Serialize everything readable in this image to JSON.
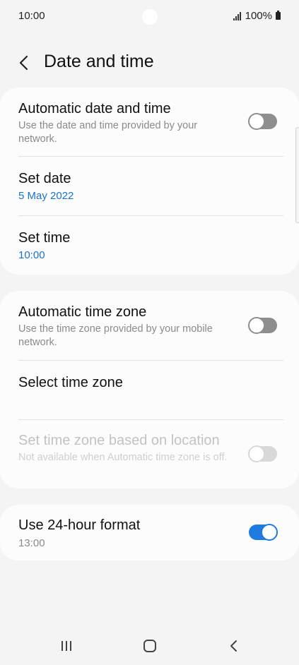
{
  "status_bar": {
    "time": "10:00",
    "battery_text": "100%"
  },
  "header": {
    "title": "Date and time"
  },
  "sections": {
    "automatic_date_time": {
      "title": "Automatic date and time",
      "subtitle": "Use the date and time provided by your network.",
      "enabled": false
    },
    "set_date": {
      "title": "Set date",
      "value": "5 May 2022"
    },
    "set_time": {
      "title": "Set time",
      "value": "10:00"
    },
    "automatic_time_zone": {
      "title": "Automatic time zone",
      "subtitle": "Use the time zone provided by your mobile network.",
      "enabled": false
    },
    "select_time_zone": {
      "title": "Select time zone"
    },
    "time_zone_location": {
      "title": "Set time zone based on location",
      "subtitle": "Not available when Automatic time zone is off.",
      "enabled": false,
      "disabled": true
    },
    "use_24_hour": {
      "title": "Use 24-hour format",
      "value": "13:00",
      "enabled": true
    }
  },
  "colors": {
    "accent": "#1f7be0",
    "link_value": "#1a73c8",
    "background": "#f4f4f4",
    "card": "#fcfcfc"
  },
  "nav_bar": {
    "icons": [
      "recents-icon",
      "home-icon",
      "back-nav-icon"
    ]
  }
}
